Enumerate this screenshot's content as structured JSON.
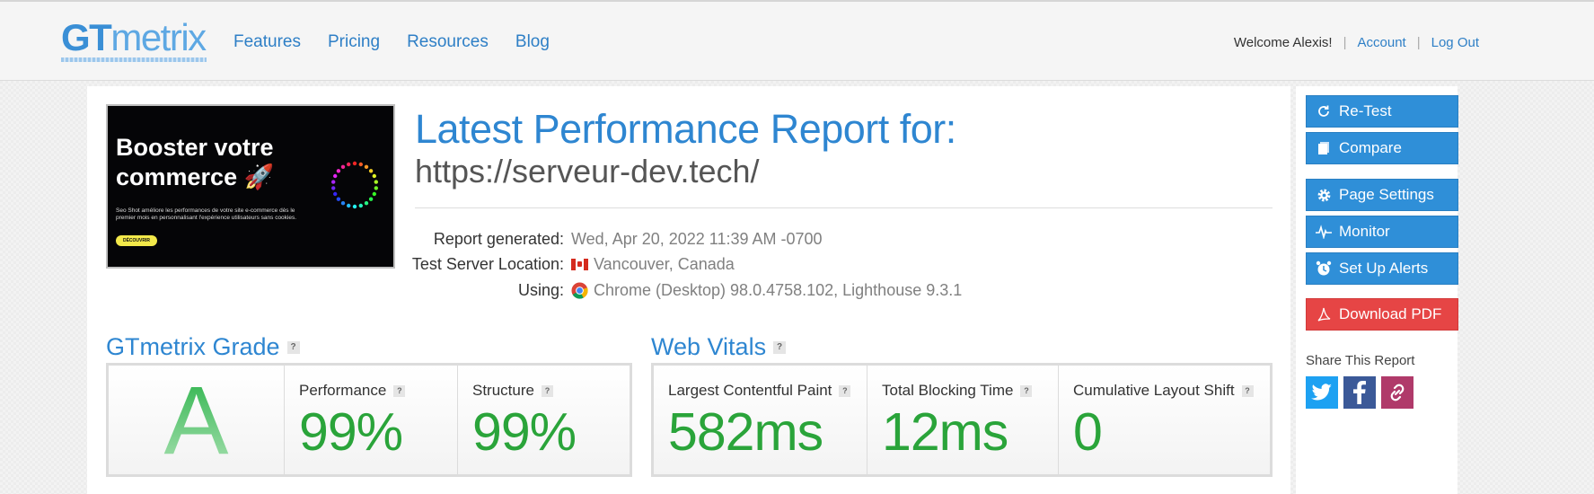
{
  "header": {
    "logo_gt": "GT",
    "logo_metrix": "metrix",
    "nav": [
      "Features",
      "Pricing",
      "Resources",
      "Blog"
    ],
    "welcome": "Welcome Alexis!",
    "account": "Account",
    "logout": "Log Out"
  },
  "thumbnail": {
    "headline": "Booster votre commerce 🚀",
    "body": "Seo Shot améliore les performances de votre site e-commerce dès le premier mois en personnalisant l'expérience utilisateurs sans cookies.",
    "button": "DÉCOUVRIR"
  },
  "report": {
    "title": "Latest Performance Report for:",
    "url": "https://serveur-dev.tech/",
    "generated_label": "Report generated:",
    "generated_value": "Wed, Apr 20, 2022 11:39 AM -0700",
    "location_label": "Test Server Location:",
    "location_value": "Vancouver, Canada",
    "using_label": "Using:",
    "using_value": "Chrome (Desktop) 98.0.4758.102, Lighthouse 9.3.1"
  },
  "grade": {
    "title": "GTmetrix Grade",
    "letter": "A",
    "performance_label": "Performance",
    "performance_value": "99%",
    "structure_label": "Structure",
    "structure_value": "99%"
  },
  "vitals": {
    "title": "Web Vitals",
    "lcp_label": "Largest Contentful Paint",
    "lcp_value": "582ms",
    "tbt_label": "Total Blocking Time",
    "tbt_value": "12ms",
    "cls_label": "Cumulative Layout Shift",
    "cls_value": "0"
  },
  "help_mark": "?",
  "sidebar": {
    "retest": "Re-Test",
    "compare": "Compare",
    "page_settings": "Page Settings",
    "monitor": "Monitor",
    "alerts": "Set Up Alerts",
    "pdf": "Download PDF",
    "share_label": "Share This Report"
  },
  "colors": {
    "brand_blue": "#2e86d1",
    "button_blue": "#2f8fd8",
    "pdf_red": "#e64545",
    "grade_green": "#2aa43a",
    "twitter": "#1da1f2",
    "facebook": "#3b5998",
    "link_share": "#b03a6a"
  }
}
